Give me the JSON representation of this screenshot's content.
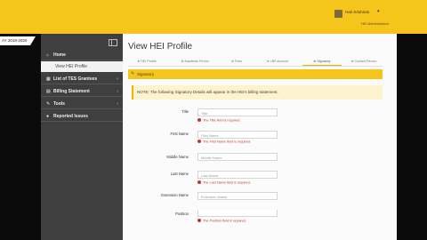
{
  "header": {
    "user_name": "Hari Krishnan",
    "user_caret": "▾",
    "user_role": "HEI Administrator"
  },
  "academic_year": "AY 2019-2020",
  "sidebar": {
    "items": [
      {
        "label": "Home",
        "icon": "home-icon",
        "glyph": "⌂"
      },
      {
        "label": "View HEI Profile",
        "icon": "",
        "glyph": ""
      },
      {
        "label": "List of TES Grantees",
        "icon": "list-icon",
        "glyph": "▦",
        "chevron": "‹"
      },
      {
        "label": "Billing Statement",
        "icon": "file-icon",
        "glyph": "▤",
        "chevron": "‹"
      },
      {
        "label": "Tools",
        "icon": "wrench-icon",
        "glyph": "✎",
        "chevron": "‹"
      },
      {
        "label": "Reported Issues",
        "icon": "alert-icon",
        "glyph": "●"
      }
    ]
  },
  "main": {
    "title": "View HEI Profile",
    "tabs": [
      {
        "label": "HEI Profile",
        "icon": "⊕"
      },
      {
        "label": "Academic Period",
        "icon": "⊕"
      },
      {
        "label": "Fees",
        "icon": "⊕"
      },
      {
        "label": "LBP Account",
        "icon": "⊕"
      },
      {
        "label": "Signatory",
        "icon": "⊕",
        "active": true
      },
      {
        "label": "Contact Person",
        "icon": "⊕"
      }
    ],
    "panel_title": "Signatory",
    "note": "NOTE: The following Signatory Details will appear in the HEI's billing statement."
  },
  "form": {
    "title": {
      "label": "Title",
      "placeholder": "Title",
      "error": "The Title field is required."
    },
    "first_name": {
      "label": "First Name",
      "placeholder": "First Name",
      "error": "The First Name field is required."
    },
    "middle_name": {
      "label": "Middle Name",
      "placeholder": "Middle Name"
    },
    "last_name": {
      "label": "Last Name",
      "placeholder": "Last Name",
      "error": "The Last Name field is required."
    },
    "extension_name": {
      "label": "Extension Name",
      "placeholder": "Extension Name"
    },
    "position": {
      "label": "Position",
      "error": "The Position field is required."
    }
  },
  "colors": {
    "accent": "#f6c51b",
    "sidebar": "#3f3f3f",
    "error": "#c0392b"
  }
}
